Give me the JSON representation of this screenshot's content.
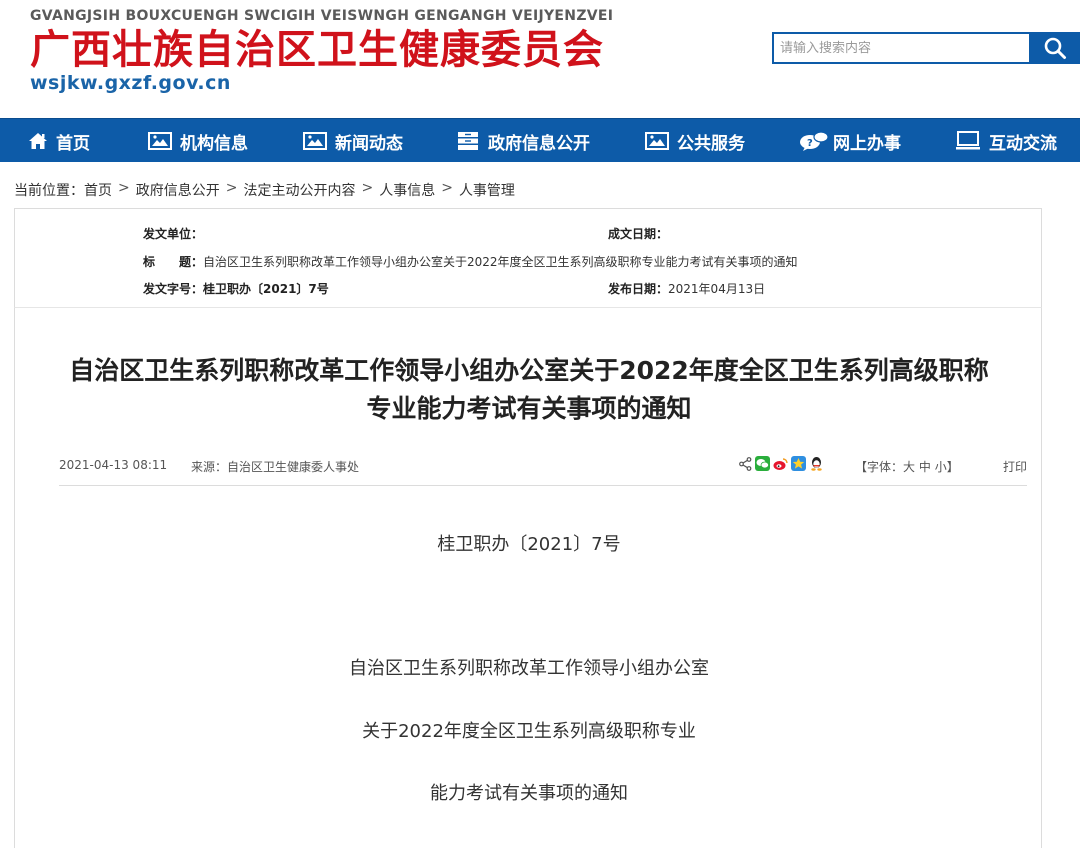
{
  "header": {
    "site_name_en": "GVANGJSIH BOUXCUENGH SWCIGIH VEISWNGH GENGANGH VEIJYENZVEI",
    "site_name_cn": "广西壮族自治区卫生健康委员会",
    "site_url": "wsjkw.gxzf.gov.cn",
    "search_placeholder": "请输入搜索内容"
  },
  "nav": {
    "items": [
      {
        "label": "首页",
        "icon": "home-icon"
      },
      {
        "label": "机构信息",
        "icon": "image-icon"
      },
      {
        "label": "新闻动态",
        "icon": "image-icon"
      },
      {
        "label": "政府信息公开",
        "icon": "cabinet-icon"
      },
      {
        "label": "公共服务",
        "icon": "image-icon"
      },
      {
        "label": "网上办事",
        "icon": "chat-icon"
      },
      {
        "label": "互动交流",
        "icon": "monitor-icon"
      }
    ]
  },
  "breadcrumb": {
    "prefix": "当前位置：",
    "items": [
      "首页",
      "政府信息公开",
      "法定主动公开内容",
      "人事信息",
      "人事管理"
    ],
    "separator": ">"
  },
  "meta": {
    "issuer_label": "发文单位：",
    "issuer_value": "",
    "created_label": "成文日期：",
    "created_value": "",
    "title_label": "标　　题：",
    "title_value": "自治区卫生系列职称改革工作领导小组办公室关于2022年度全区卫生系列高级职称专业能力考试有关事项的通知",
    "docno_label": "发文字号：",
    "docno_value": "桂卫职办〔2021〕7号",
    "published_label": "发布日期：",
    "published_value": "2021年04月13日"
  },
  "article": {
    "title_line1": "自治区卫生系列职称改革工作领导小组办公室关于2022年度全区卫生系列高级职称",
    "title_line2": "专业能力考试有关事项的通知",
    "datetime": "2021-04-13 08:11",
    "source": "来源：自治区卫生健康委人事处",
    "font_size_label": "【字体：",
    "font_sizes": [
      "大",
      "中",
      "小"
    ],
    "font_size_close": "】",
    "print_label": "打印",
    "share_icons": [
      "share-icon",
      "wechat-icon",
      "weibo-icon",
      "qzone-icon",
      "qq-icon"
    ],
    "body": [
      "桂卫职办〔2021〕7号",
      "自治区卫生系列职称改革工作领导小组办公室",
      "关于2022年度全区卫生系列高级职称专业",
      "能力考试有关事项的通知"
    ]
  },
  "colors": {
    "brand_red": "#d0121b",
    "brand_blue": "#0d5ba8",
    "url_blue": "#1a64a8"
  }
}
